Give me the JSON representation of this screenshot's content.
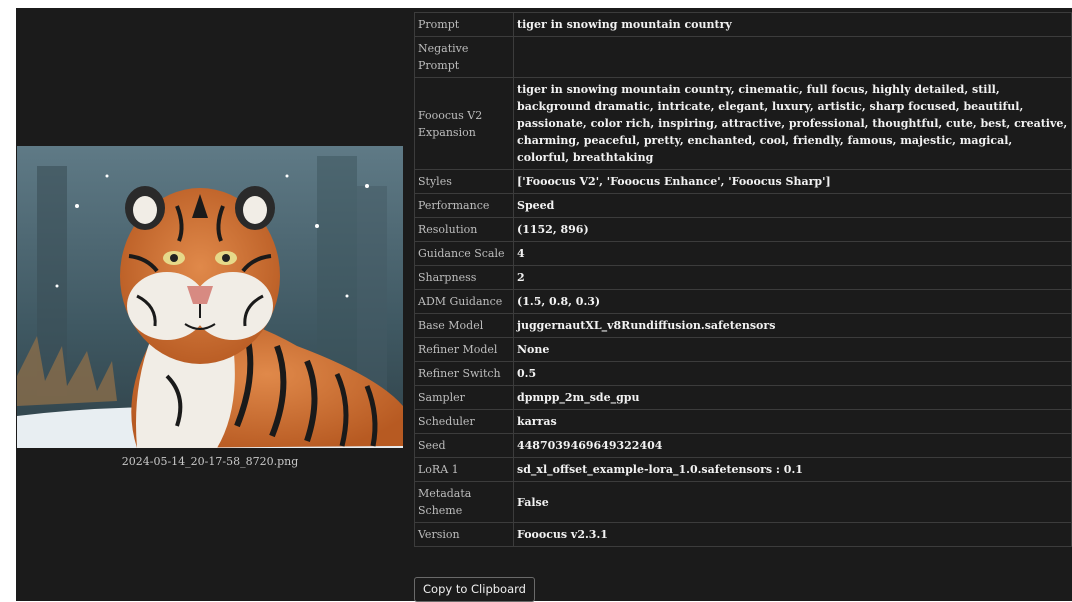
{
  "image": {
    "filename": "2024-05-14_20-17-58_8720.png"
  },
  "metadata": [
    {
      "key": "Prompt",
      "value": "tiger in snowing mountain country"
    },
    {
      "key": "Negative Prompt",
      "value": ""
    },
    {
      "key": "Fooocus V2 Expansion",
      "value": "tiger in snowing mountain country, cinematic, full focus, highly detailed, still, background dramatic, intricate, elegant, luxury, artistic, sharp focused, beautiful, passionate, color rich, inspiring, attractive, professional, thoughtful, cute, best, creative, charming, peaceful, pretty, enchanted, cool, friendly, famous, majestic, magical, colorful, breathtaking"
    },
    {
      "key": "Styles",
      "value": "['Fooocus V2', 'Fooocus Enhance', 'Fooocus Sharp']"
    },
    {
      "key": "Performance",
      "value": "Speed"
    },
    {
      "key": "Resolution",
      "value": "(1152, 896)"
    },
    {
      "key": "Guidance Scale",
      "value": "4"
    },
    {
      "key": "Sharpness",
      "value": "2"
    },
    {
      "key": "ADM Guidance",
      "value": "(1.5, 0.8, 0.3)"
    },
    {
      "key": "Base Model",
      "value": "juggernautXL_v8Rundiffusion.safetensors"
    },
    {
      "key": "Refiner Model",
      "value": "None"
    },
    {
      "key": "Refiner Switch",
      "value": "0.5"
    },
    {
      "key": "Sampler",
      "value": "dpmpp_2m_sde_gpu"
    },
    {
      "key": "Scheduler",
      "value": "karras"
    },
    {
      "key": "Seed",
      "value": "4487039469649322404"
    },
    {
      "key": "LoRA 1",
      "value": "sd_xl_offset_example-lora_1.0.safetensors : 0.1"
    },
    {
      "key": "Metadata Scheme",
      "value": "False"
    },
    {
      "key": "Version",
      "value": "Fooocus v2.3.1"
    }
  ],
  "actions": {
    "copy_label": "Copy to Clipboard"
  }
}
